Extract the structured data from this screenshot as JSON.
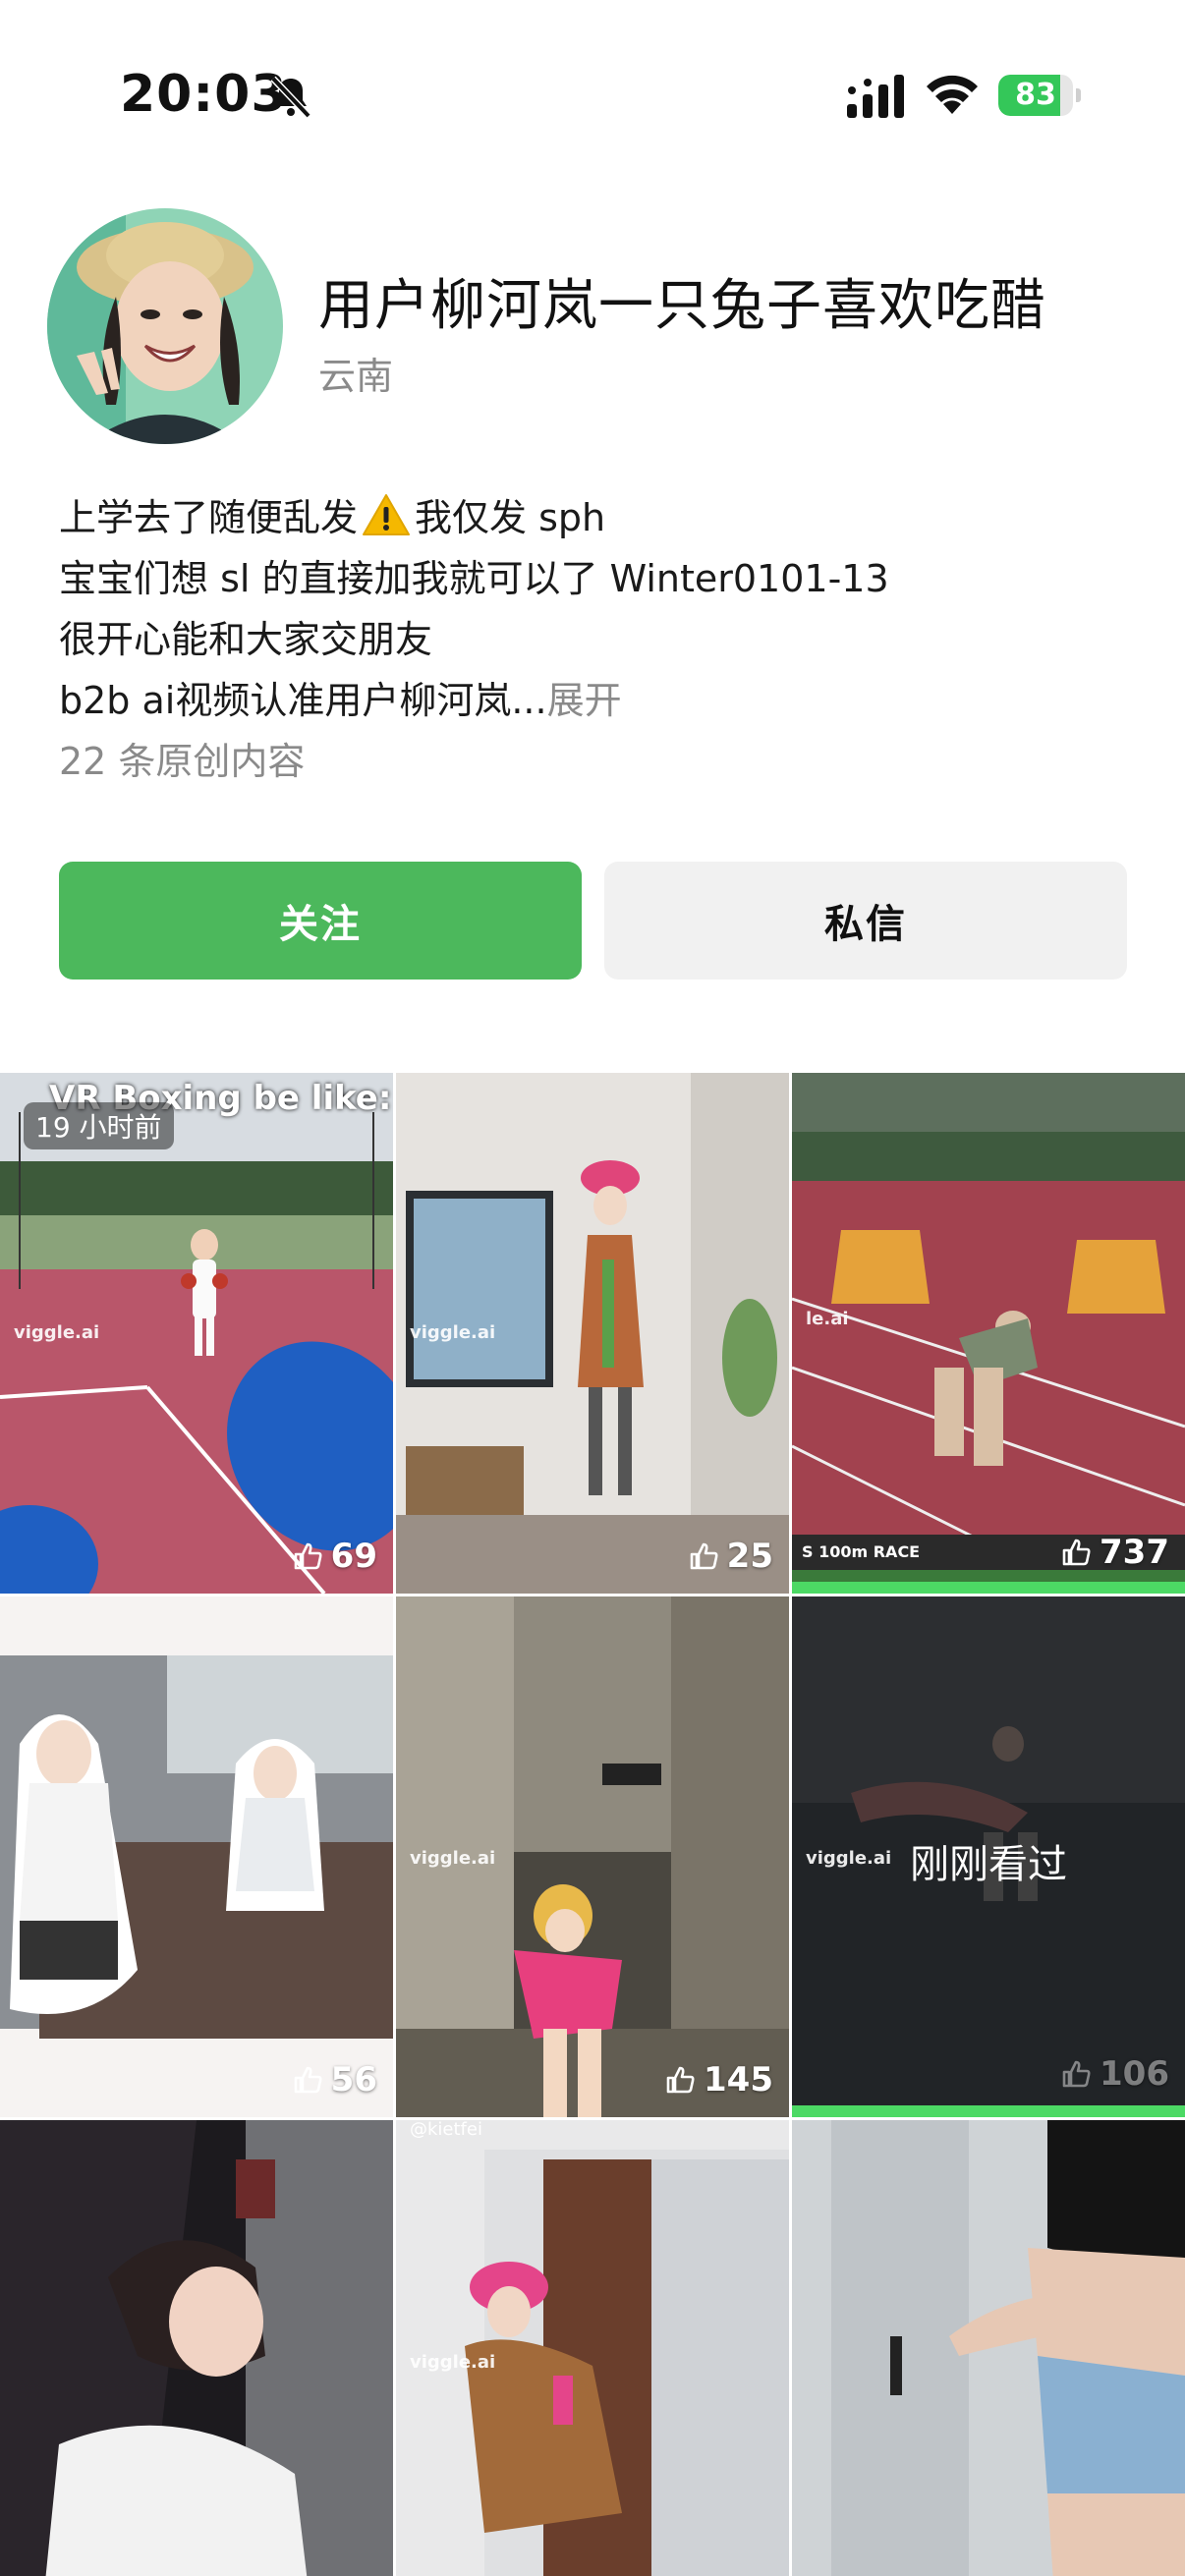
{
  "status_bar": {
    "time": "20:03",
    "battery": "83",
    "battery_level": 0.83,
    "accent": "#34c759"
  },
  "profile": {
    "name": "用户柳河岚一只兔子喜欢吃醋",
    "location": "云南",
    "bio": {
      "line1_a": "上学去了随便乱发",
      "line1_b": "我仅发 sph",
      "line2": "宝宝们想 sl 的直接加我就可以了 Winter0101-13",
      "line3": "很开心能和大家交朋友",
      "line4": "b2b ai视频认准用户柳河岚...",
      "expand": "展开"
    },
    "original_count": "22 条原创内容"
  },
  "actions": {
    "follow": "关注",
    "message": "私信",
    "follow_color": "#4cb85c"
  },
  "videos": [
    {
      "likes": "69",
      "badge": "19 小时前",
      "caption": "VR Boxing be like:",
      "watermark": "viggle.ai"
    },
    {
      "likes": "25",
      "watermark": "viggle.ai"
    },
    {
      "likes": "737",
      "watermark": "le.ai",
      "banner": "S 100m RACE",
      "progress": 1.0
    },
    {
      "likes": "56"
    },
    {
      "likes": "145",
      "watermark": "viggle.ai"
    },
    {
      "likes": "106",
      "watermark": "viggle.ai",
      "overlay": "刚刚看过",
      "progress": 1.0
    },
    {},
    {
      "watermark": "viggle.ai",
      "top_caption": "@kietfei"
    },
    {}
  ]
}
